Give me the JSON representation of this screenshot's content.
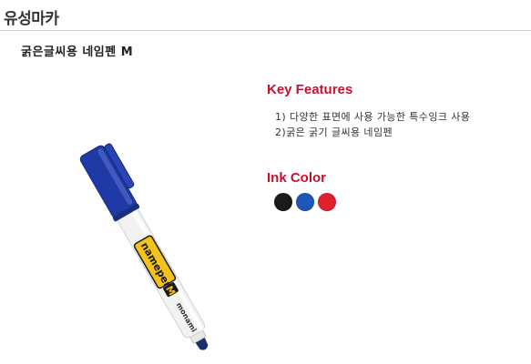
{
  "category": {
    "title": "유성마카"
  },
  "product": {
    "name": "굵은글씨용 네임펜 M"
  },
  "pen": {
    "brand_text": "monami",
    "logo_text": "namepen",
    "size_text": "M",
    "cap_color": "#1f3aa6",
    "barrel_color": "#f2f3f0",
    "label_color": "#f4c21c",
    "tip_color": "#1b2e6e"
  },
  "features": {
    "heading": "Key Features",
    "items": [
      "1) 다양한 표면에 사용 가능한 특수잉크 사용",
      "2)굵은 굵기 글씨용 네임펜"
    ]
  },
  "ink": {
    "heading": "Ink Color",
    "colors": [
      {
        "name": "black",
        "hex": "#1a1a1a"
      },
      {
        "name": "blue",
        "hex": "#1f56b8"
      },
      {
        "name": "red",
        "hex": "#e0202d"
      }
    ]
  }
}
